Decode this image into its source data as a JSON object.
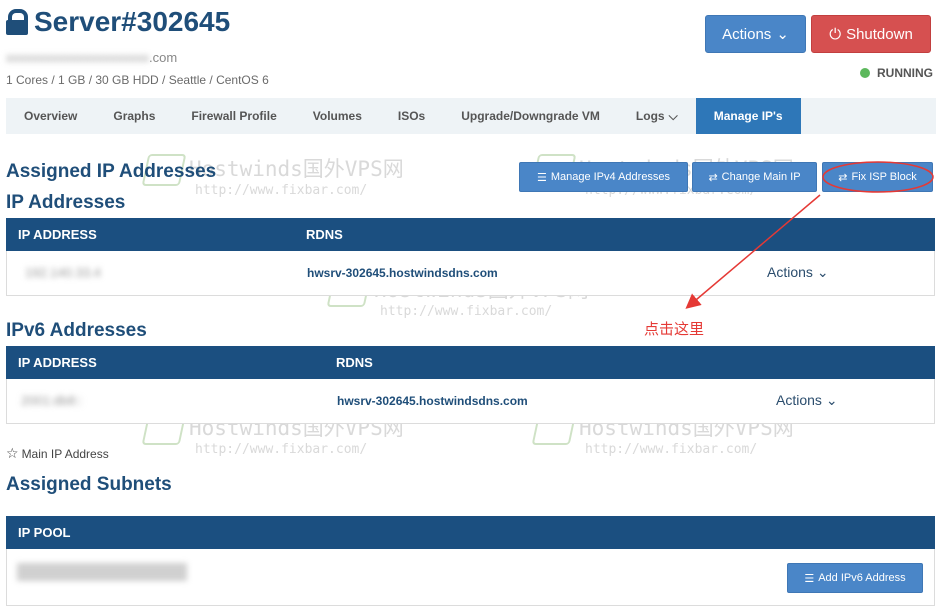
{
  "server": {
    "title": "Server#302645",
    "hostname": "hwsrv-302645.hostwindsdns.com",
    "hostname_visible": ".com",
    "specs": "1 Cores / 1 GB / 30 GB HDD / Seattle / CentOS 6",
    "status": "RUNNING"
  },
  "header_buttons": {
    "actions": "Actions",
    "shutdown": "Shutdown"
  },
  "tabs": [
    {
      "label": "Overview"
    },
    {
      "label": "Graphs"
    },
    {
      "label": "Firewall Profile"
    },
    {
      "label": "Volumes"
    },
    {
      "label": "ISOs"
    },
    {
      "label": "Upgrade/Downgrade VM"
    },
    {
      "label": "Logs"
    },
    {
      "label": "Manage IP's"
    }
  ],
  "assigned": {
    "title": "Assigned IP Addresses",
    "buttons": {
      "manage_ipv4": "Manage IPv4 Addresses",
      "change_main_ip": "Change Main IP",
      "fix_isp_block": "Fix ISP Block"
    }
  },
  "ipv4": {
    "title": "IP Addresses",
    "columns": [
      "IP ADDRESS",
      "RDNS"
    ],
    "rows": [
      {
        "ip": "192.140.33.4",
        "rdns": "hwsrv-302645.hostwindsdns.com",
        "action": "Actions"
      }
    ]
  },
  "ipv6": {
    "title": "IPv6 Addresses",
    "columns": [
      "IP ADDRESS",
      "RDNS"
    ],
    "rows": [
      {
        "ip": "2001:db8::",
        "rdns": "hwsrv-302645.hostwindsdns.com",
        "action": "Actions"
      }
    ]
  },
  "main_ip_note": "Main IP Address",
  "subnets": {
    "title": "Assigned Subnets",
    "columns": [
      "IP POOL"
    ],
    "add_ipv6": "Add IPv6 Address"
  },
  "annotation": "点击这里",
  "watermark": {
    "title": "Hostwinds国外VPS网",
    "url": "http://www.fixbar.com/"
  },
  "colors": {
    "primary": "#1f4e79",
    "button": "#4a86c8",
    "danger": "#d65050",
    "running": "#5cb85c",
    "annotation": "#e53935"
  }
}
